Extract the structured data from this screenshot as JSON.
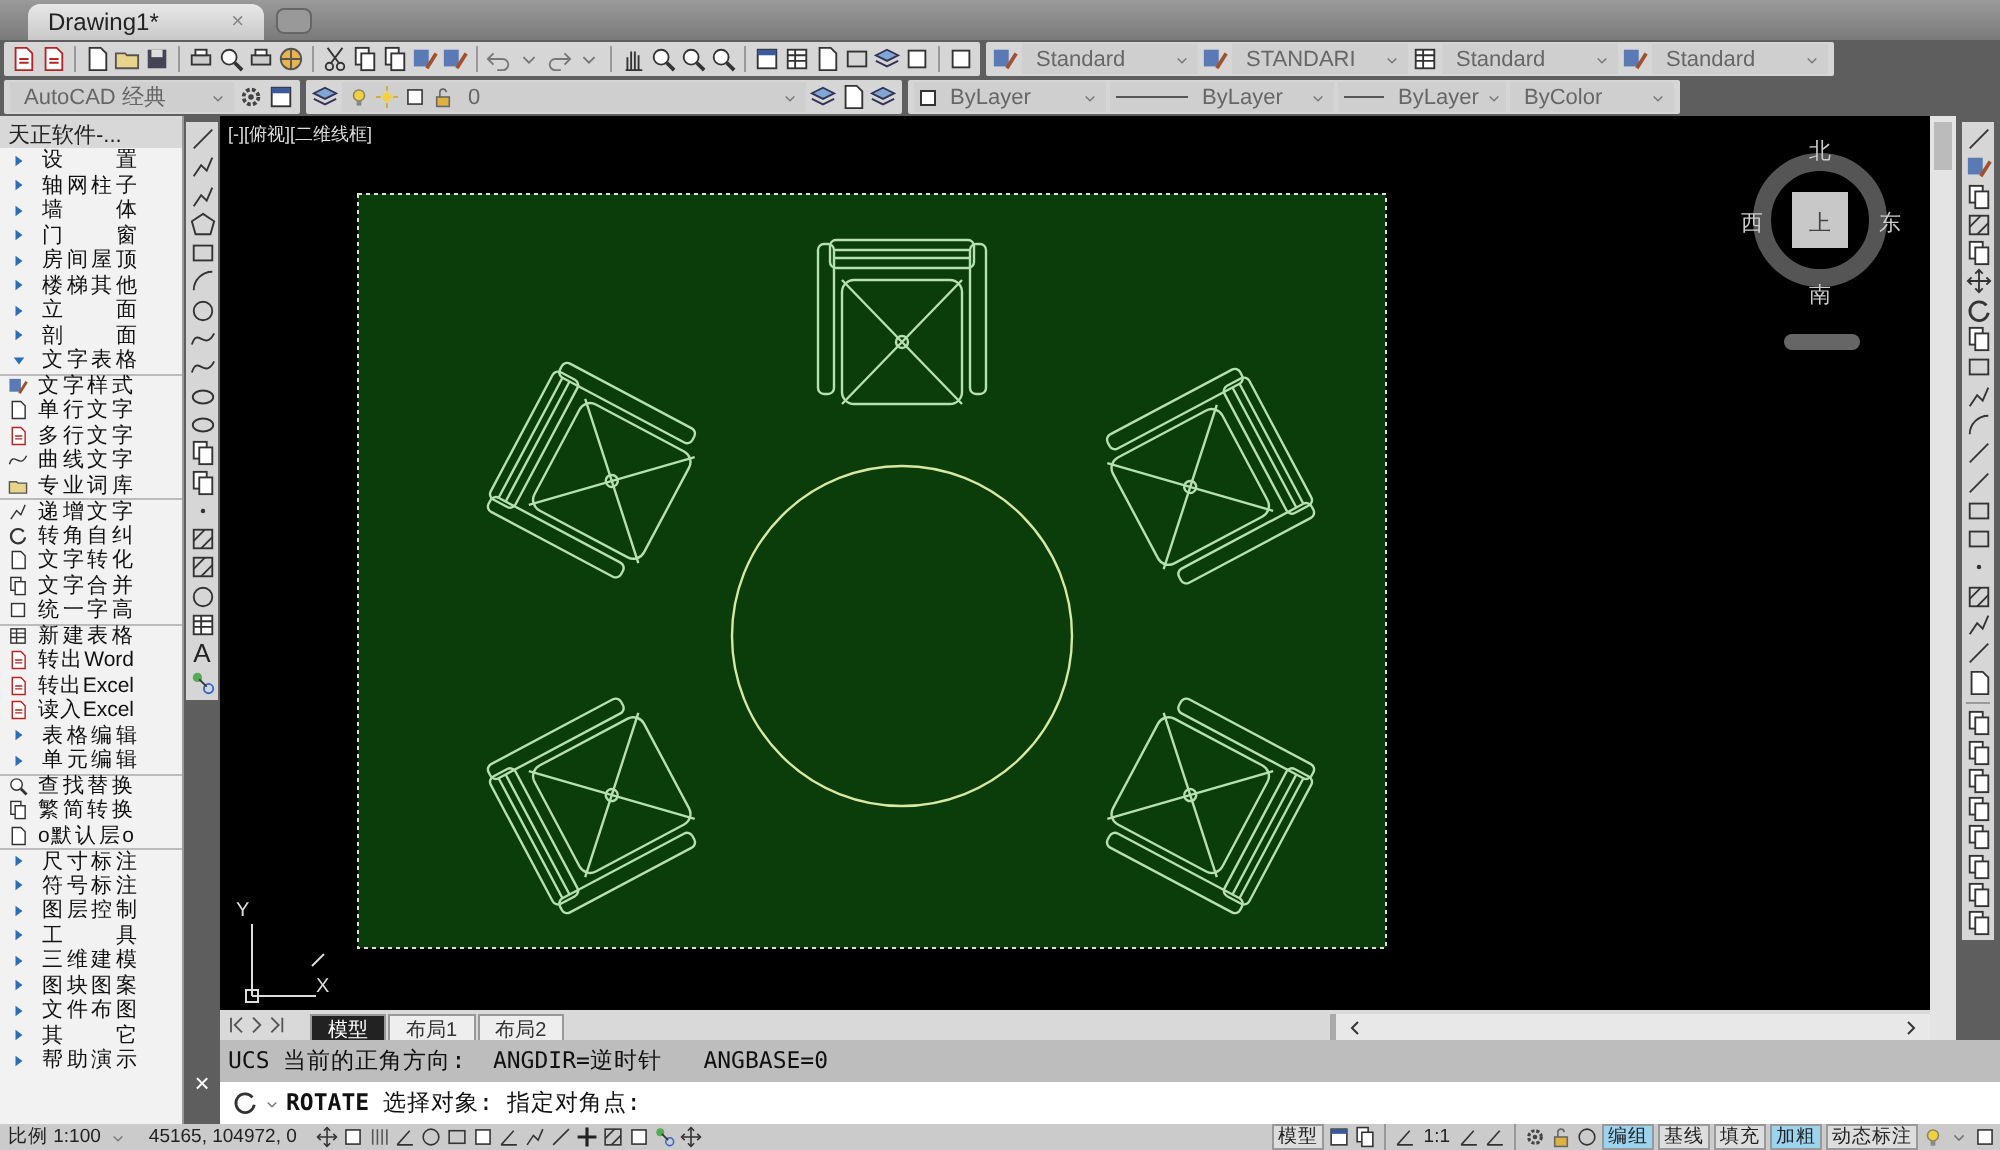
{
  "document_tabs": [
    {
      "label": "Drawing1*",
      "selected": true,
      "close_glyph": "×"
    }
  ],
  "style_toolbar": {
    "dropdowns": [
      {
        "kind": "text_style",
        "value": "Standard"
      },
      {
        "kind": "dim_style",
        "value": "STANDARI"
      },
      {
        "kind": "table_style",
        "value": "Standard"
      },
      {
        "kind": "mleader_style",
        "value": "Standard"
      }
    ]
  },
  "properties_toolbar": {
    "workspace": "AutoCAD 经典",
    "layer": "0",
    "color_setting": "ByLayer",
    "linetype": "ByLayer",
    "lineweight": "ByLayer",
    "plot_style": "ByColor"
  },
  "side_panel": {
    "title": "天正软件-...",
    "items": [
      {
        "kind": "group",
        "label": "设 置",
        "expanded": false
      },
      {
        "kind": "group",
        "label": "轴网柱子",
        "expanded": false
      },
      {
        "kind": "group",
        "label": "墙 体",
        "expanded": false
      },
      {
        "kind": "group",
        "label": "门 窗",
        "expanded": false
      },
      {
        "kind": "group",
        "label": "房间屋顶",
        "expanded": false
      },
      {
        "kind": "group",
        "label": "楼梯其他",
        "expanded": false
      },
      {
        "kind": "group",
        "label": "立 面",
        "expanded": false
      },
      {
        "kind": "group",
        "label": "剖 面",
        "expanded": false
      },
      {
        "kind": "group",
        "label": "文字表格",
        "expanded": true,
        "children": [
          {
            "kind": "tool",
            "label": "文字样式",
            "divider_before": true
          },
          {
            "kind": "tool",
            "label": "单行文字"
          },
          {
            "kind": "tool",
            "label": "多行文字"
          },
          {
            "kind": "tool",
            "label": "曲线文字"
          },
          {
            "kind": "tool",
            "label": "专业词库"
          },
          {
            "kind": "tool",
            "label": "递增文字",
            "divider_before": true
          },
          {
            "kind": "tool",
            "label": "转角自纠"
          },
          {
            "kind": "tool",
            "label": "文字转化"
          },
          {
            "kind": "tool",
            "label": "文字合并"
          },
          {
            "kind": "tool",
            "label": "统一字高"
          },
          {
            "kind": "tool",
            "label": "新建表格",
            "divider_before": true
          },
          {
            "kind": "tool",
            "label": "转出Word"
          },
          {
            "kind": "tool",
            "label": "转出Excel"
          },
          {
            "kind": "tool",
            "label": "读入Excel"
          },
          {
            "kind": "group",
            "label": "表格编辑",
            "expanded": false
          },
          {
            "kind": "group",
            "label": "单元编辑",
            "expanded": false
          },
          {
            "kind": "tool",
            "label": "查找替换",
            "divider_before": true
          },
          {
            "kind": "tool",
            "label": "繁简转换"
          },
          {
            "kind": "tool",
            "label": "o默认层o"
          }
        ]
      },
      {
        "kind": "group",
        "label": "尺寸标注",
        "expanded": false,
        "divider_before": true
      },
      {
        "kind": "group",
        "label": "符号标注",
        "expanded": false
      },
      {
        "kind": "group",
        "label": "图层控制",
        "expanded": false
      },
      {
        "kind": "group",
        "label": "工 具",
        "expanded": false
      },
      {
        "kind": "group",
        "label": "三维建模",
        "expanded": false
      },
      {
        "kind": "group",
        "label": "图块图案",
        "expanded": false
      },
      {
        "kind": "group",
        "label": "文件布图",
        "expanded": false
      },
      {
        "kind": "group",
        "label": "其 它",
        "expanded": false
      },
      {
        "kind": "group",
        "label": "帮助演示",
        "expanded": false
      }
    ]
  },
  "draw_toolbar": {
    "text_tool": "A"
  },
  "viewport": {
    "label": "[-][俯视][二维线框]",
    "compass": {
      "north": "北",
      "south": "南",
      "east": "东",
      "west": "西",
      "top": "上"
    },
    "ucs": {
      "x": "X",
      "y": "Y"
    }
  },
  "layout_tabs": [
    {
      "label": "模型",
      "selected": true
    },
    {
      "label": "布局1",
      "selected": false
    },
    {
      "label": "布局2",
      "selected": false
    }
  ],
  "command_line": {
    "close_glyph": "×",
    "history": "UCS 当前的正角方向:  ANGDIR=逆时针   ANGBASE=0",
    "prompt": "**ROTATE** 选择对象: 指定对角点:"
  },
  "status_bar": {
    "scale": "比例 1:100",
    "coordinates": "45165, 104972, 0",
    "model": "模型",
    "annotation_scale": "1:1",
    "toggles": [
      {
        "label": "编组",
        "on": true
      },
      {
        "label": "基线",
        "on": false
      },
      {
        "label": "填充",
        "on": false
      },
      {
        "label": "加粗",
        "on": true
      },
      {
        "label": "动态标注",
        "on": false
      }
    ]
  }
}
